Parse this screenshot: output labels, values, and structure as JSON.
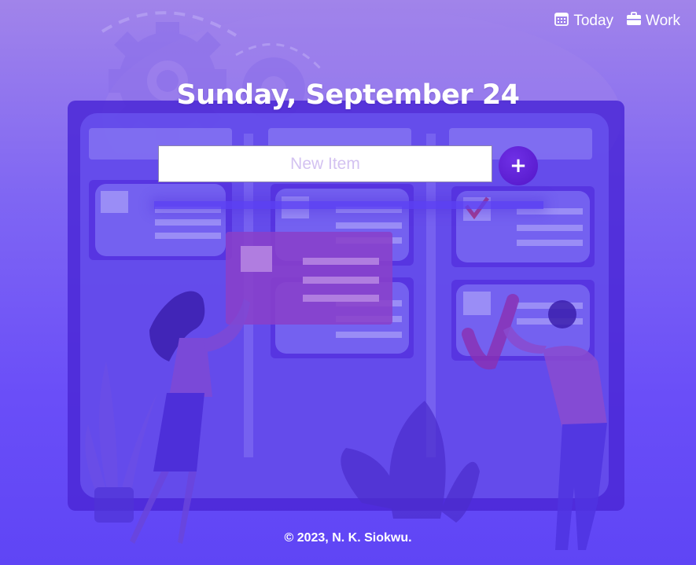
{
  "nav": {
    "today": {
      "label": "Today",
      "icon": "calendar-icon"
    },
    "work": {
      "label": "Work",
      "icon": "briefcase-icon"
    }
  },
  "page": {
    "title": "Sunday, September 24"
  },
  "new_item": {
    "placeholder": "New Item",
    "value": "",
    "add_label": "+"
  },
  "footer": {
    "text": "© 2023, N. K. Siokwu."
  },
  "colors": {
    "background_top": "#a184ea",
    "background_bottom": "#5f45f5",
    "add_button": "#5a1bd0"
  }
}
